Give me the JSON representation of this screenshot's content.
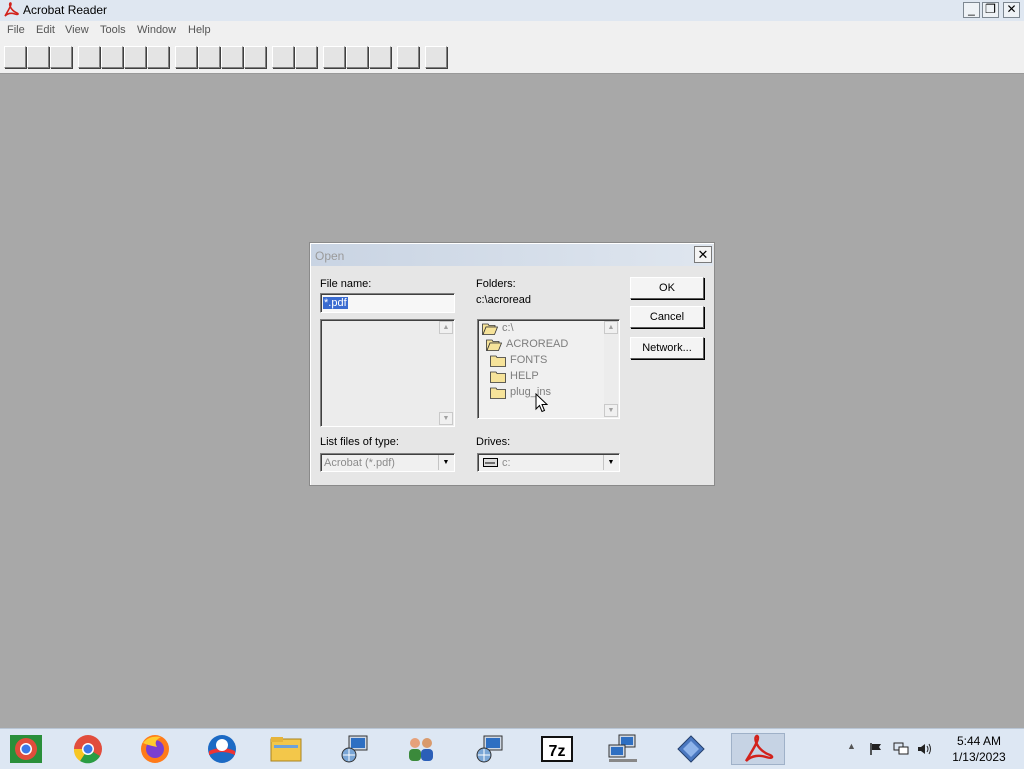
{
  "window": {
    "title": "Acrobat Reader",
    "controls": {
      "minimize": "_",
      "maximize": "❐",
      "close": "✕"
    }
  },
  "menu": [
    "File",
    "Edit",
    "View",
    "Tools",
    "Window",
    "Help"
  ],
  "dialog": {
    "title": "Open",
    "file_name_label": "File name:",
    "file_name_value": "*.pdf",
    "folders_label": "Folders:",
    "current_path": "c:\\acroread",
    "folders": [
      {
        "name": "c:\\",
        "icon": "open-folder-icon"
      },
      {
        "name": "ACROREAD",
        "icon": "open-folder-icon"
      },
      {
        "name": "FONTS",
        "icon": "folder-icon"
      },
      {
        "name": "HELP",
        "icon": "folder-icon"
      },
      {
        "name": "plug_ins",
        "icon": "folder-icon"
      }
    ],
    "list_type_label": "List files of type:",
    "list_type_value": "Acrobat (*.pdf)",
    "drives_label": "Drives:",
    "drive_value": "c:",
    "buttons": {
      "ok": "OK",
      "cancel": "Cancel",
      "network": "Network..."
    }
  },
  "taskbar": {
    "apps": [
      "chrome-icon",
      "chrome-icon",
      "firefox-icon",
      "opera-icon",
      "file-explorer-icon",
      "network-setup-icon",
      "users-icon",
      "network-setup-icon",
      "7zip-icon",
      "computer-network-icon",
      "diamond-app-icon",
      "acrobat-icon"
    ],
    "icon_7zip_text": "7z",
    "time": "5:44 AM",
    "date": "1/13/2023"
  },
  "colors": {
    "desktop": "#a8a8a8",
    "acrobat_red": "#d2221c",
    "dialog_bg": "#e6e6e6",
    "selection": "#3a6bd0"
  }
}
